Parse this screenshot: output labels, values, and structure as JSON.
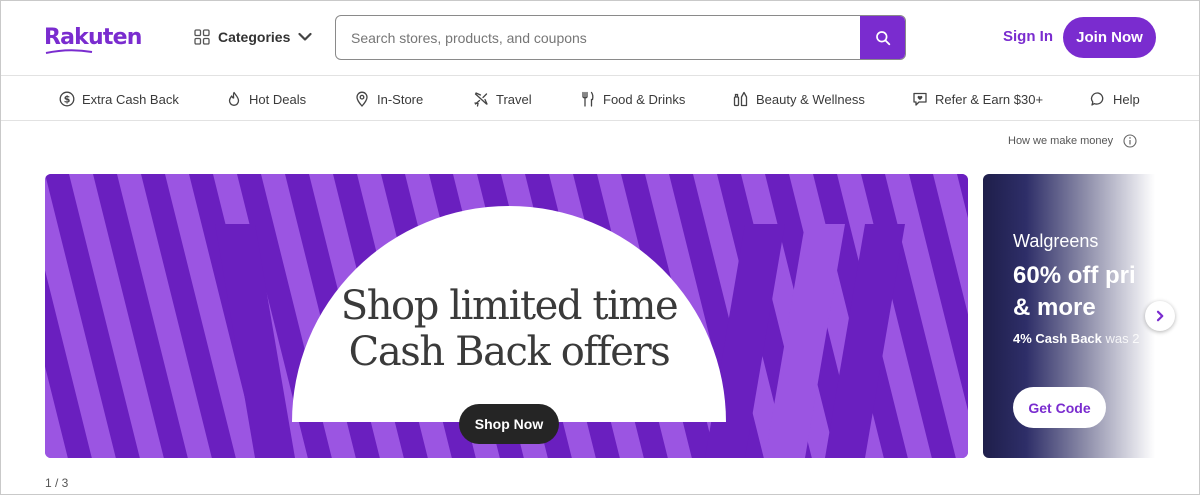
{
  "header": {
    "logo": "Rakuten",
    "categories_label": "Categories",
    "search_placeholder": "Search stores, products, and coupons",
    "signin_label": "Sign In",
    "join_label": "Join Now"
  },
  "nav": {
    "items": [
      {
        "label": "Extra Cash Back",
        "icon": "dollar-circle-icon"
      },
      {
        "label": "Hot Deals",
        "icon": "flame-icon"
      },
      {
        "label": "In-Store",
        "icon": "map-pin-icon"
      },
      {
        "label": "Travel",
        "icon": "plane-icon"
      },
      {
        "label": "Food & Drinks",
        "icon": "fork-knife-icon"
      },
      {
        "label": "Beauty & Wellness",
        "icon": "beauty-bottles-icon"
      },
      {
        "label": "Refer & Earn $30+",
        "icon": "chat-heart-icon"
      },
      {
        "label": "Help",
        "icon": "chat-bubble-icon"
      }
    ]
  },
  "money_label": "How we make money",
  "hero": {
    "line1": "Shop limited time",
    "line2": "Cash Back offers",
    "button": "Shop Now"
  },
  "card2": {
    "brand": "Walgreens",
    "offer_line1": "60% off pri",
    "offer_line2": "& more",
    "cashback": "4% Cash Back",
    "was": "was 2",
    "button": "Get Code"
  },
  "pager": "1 / 3",
  "colors": {
    "brand_purple": "#7a2ccf",
    "banner_light": "#9b55e2",
    "banner_dark": "#6a1fbf",
    "button_dark": "#252525"
  }
}
